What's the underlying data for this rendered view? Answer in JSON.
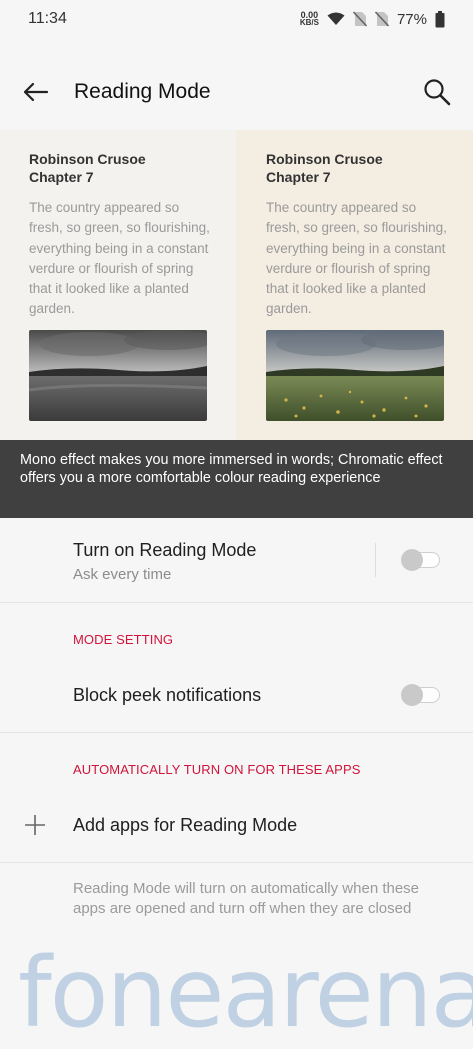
{
  "status_bar": {
    "time": "11:34",
    "net_speed_value": "0.00",
    "net_speed_unit": "KB/S",
    "battery": "77%",
    "icons": [
      "wifi-icon",
      "no-sim-icon",
      "no-sim-icon",
      "battery-icon"
    ]
  },
  "app_bar": {
    "title": "Reading Mode",
    "back_icon": "arrow-left-icon",
    "search_icon": "search-icon"
  },
  "preview": {
    "mono": {
      "title_line1": "Robinson Crusoe",
      "title_line2": "Chapter 7",
      "text": "The country appeared so fresh, so green, so flourishing, everything being in a constant verdure or flourish of spring that it looked like a planted garden."
    },
    "chromatic": {
      "title_line1": "Robinson Crusoe",
      "title_line2": "Chapter 7",
      "text": "The country appeared so fresh, so green, so flourishing, everything being in a constant verdure or flourish of spring that it looked like a planted garden."
    }
  },
  "tip": "Mono effect makes you more immersed in words; Chromatic effect offers you a more comfortable colour reading experience",
  "reading_mode": {
    "title": "Turn on Reading Mode",
    "subtitle": "Ask every time",
    "enabled": false
  },
  "mode_setting": {
    "header": "MODE SETTING",
    "block_peek_label": "Block peek notifications",
    "block_peek_enabled": false
  },
  "auto_apps": {
    "header": "AUTOMATICALLY TURN ON FOR THESE APPS",
    "add_label": "Add apps for Reading Mode",
    "footnote": "Reading Mode will turn on automatically when these apps are opened and turn off when they are closed"
  },
  "watermark": "fonearena",
  "colors": {
    "accent": "#d0143b",
    "tip_background": "#404040",
    "page_background": "#f6f6f6"
  }
}
